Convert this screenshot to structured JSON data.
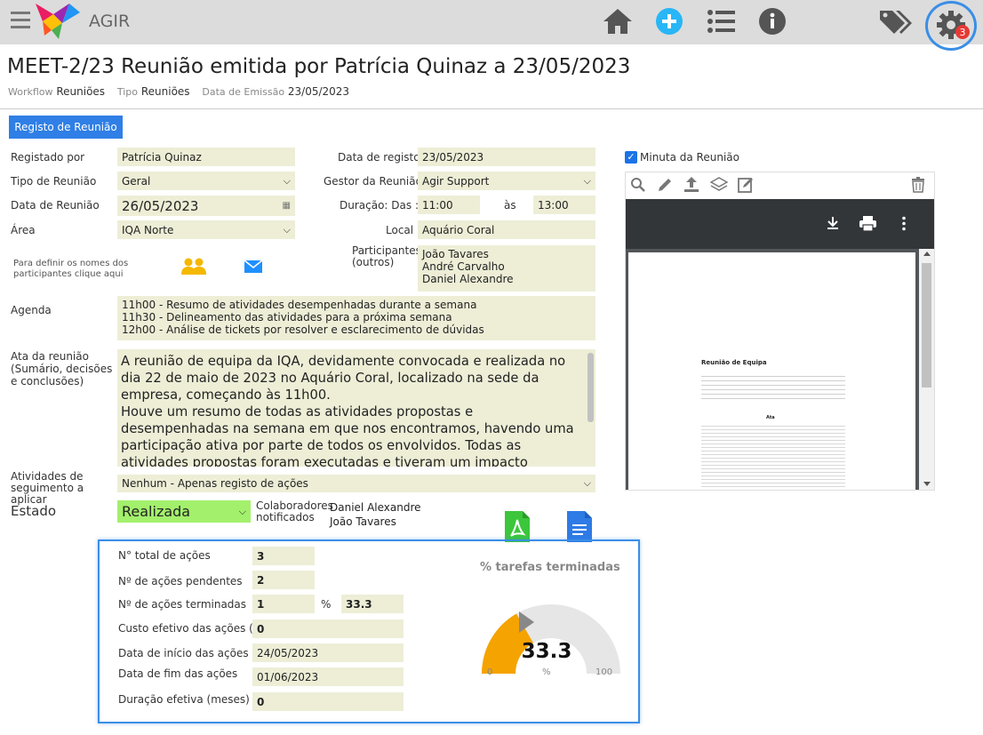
{
  "app": {
    "name": "AGIR",
    "notif_count": "3"
  },
  "page": {
    "title": "MEET-2/23 Reunião emitida por Patrícia Quinaz a 23/05/2023",
    "meta": {
      "workflow_label": "Workflow",
      "workflow_value": "Reuniões",
      "tipo_label": "Tipo",
      "tipo_value": "Reuniões",
      "data_label": "Data de Emissão",
      "data_value": "23/05/2023"
    }
  },
  "tab": {
    "label": "Registo de Reunião"
  },
  "form": {
    "registado_por": {
      "label": "Registado por",
      "value": "Patrícia Quinaz"
    },
    "tipo_reuniao": {
      "label": "Tipo de Reunião",
      "value": "Geral"
    },
    "data_reuniao": {
      "label": "Data de Reunião",
      "value": "26/05/2023"
    },
    "area": {
      "label": "Área",
      "value": "IQA Norte"
    },
    "data_registo": {
      "label": "Data de registo",
      "value": "23/05/2023"
    },
    "gestor": {
      "label": "Gestor da Reunião",
      "value": "Agir Support"
    },
    "duracao": {
      "label": "Duração: Das :",
      "from": "11:00",
      "sep": "às",
      "to": "13:00"
    },
    "local": {
      "label": "Local",
      "value": "Aquário Coral"
    },
    "participantes_hint": "Para definir os nomes dos participantes clique aqui",
    "participantes_outros": {
      "label": "Participantes (outros)",
      "values": [
        "João Tavares",
        "André Carvalho",
        "Daniel Alexandre"
      ]
    },
    "agenda": {
      "label": "Agenda",
      "lines": [
        "11h00 - Resumo de atividades desempenhadas durante a semana",
        "11h30 - Delineamento das atividades para a próxima semana",
        "12h00 - Análise de tickets por resolver e esclarecimento de dúvidas"
      ]
    },
    "ata": {
      "label": "Ata da reunião (Sumário, decisões e conclusões)",
      "text": "A reunião de equipa da IQA, devidamente convocada e realizada no dia 22 de maio de 2023 no Aquário Coral, localizado na sede da empresa, começando às 11h00.\nHouve um resumo de todas as atividades propostas e desempenhadas na semana em que nos encontramos, havendo uma participação ativa por parte de todos os envolvidos. Todas as atividades propostas foram executadas e tiveram um impacto positivo na atividade da empresa."
    },
    "atividades": {
      "label": "Atividades de seguimento a aplicar",
      "value": "Nenhum - Apenas registo de ações"
    },
    "estado": {
      "label": "Estado",
      "value": "Realizada"
    },
    "colaboradores": {
      "label": "Colaboradores notificados",
      "values": [
        "Daniel Alexandre",
        "João Tavares"
      ]
    }
  },
  "minuta": {
    "checkbox_label": "Minuta da Reunião",
    "checked": true
  },
  "stats": {
    "total": {
      "label": "N° total de ações",
      "value": "3"
    },
    "pendentes": {
      "label": "Nº de ações pendentes",
      "value": "2"
    },
    "terminadas": {
      "label": "Nº de ações terminadas",
      "value": "1",
      "pct_label": "%",
      "pct_value": "33.3"
    },
    "custo": {
      "label": "Custo efetivo das ações (€)",
      "value": "0"
    },
    "inicio": {
      "label": "Data de início das ações",
      "value": "24/05/2023"
    },
    "fim": {
      "label": "Data de fim das ações",
      "value": "01/06/2023"
    },
    "duracao": {
      "label": "Duração efetiva (meses)",
      "value": "0"
    }
  },
  "gauge": {
    "title": "% tarefas terminadas",
    "value": 33.3,
    "value_text": "33.3",
    "min": "0",
    "max": "100",
    "unit": "%",
    "color": "#f5a300"
  },
  "doc_preview": {
    "heading": "Reunião de Equipa",
    "section": "Ata"
  }
}
